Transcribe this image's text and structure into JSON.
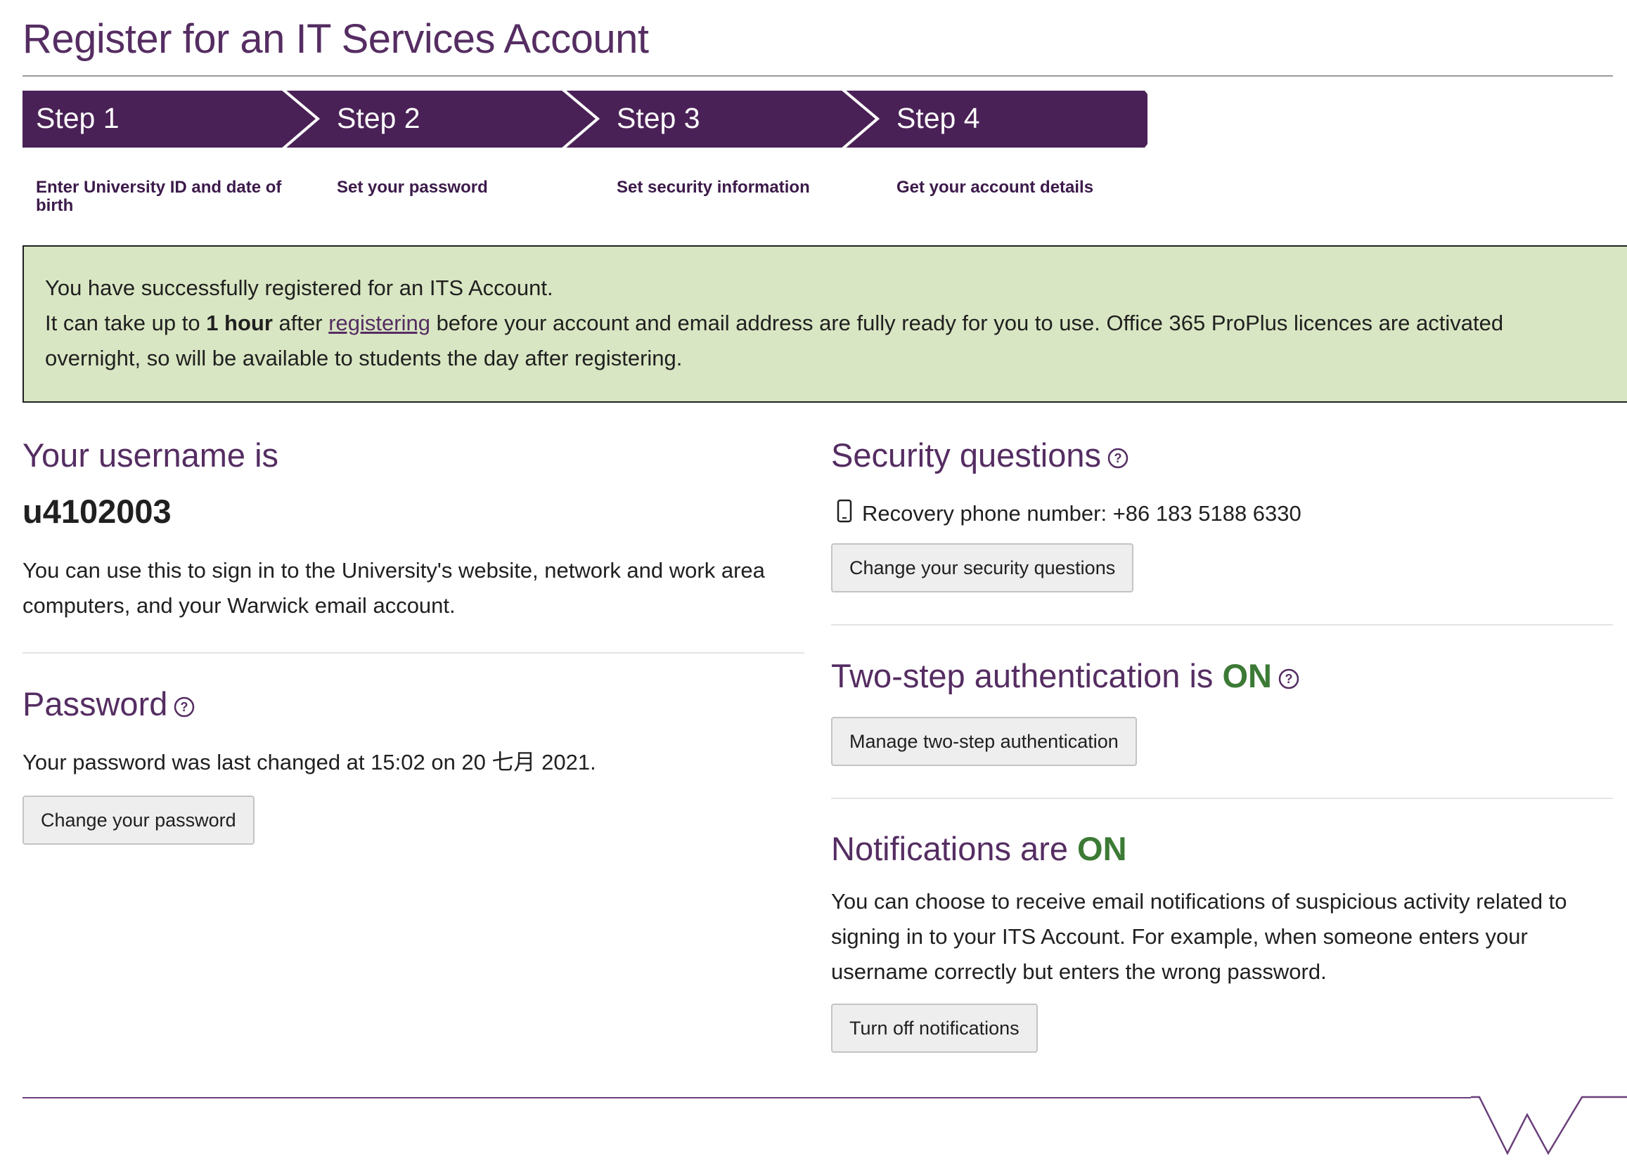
{
  "page": {
    "title": "Register for an IT Services Account"
  },
  "steps": [
    {
      "title": "Step 1",
      "description": "Enter University ID and date of birth"
    },
    {
      "title": "Step 2",
      "description": "Set your password"
    },
    {
      "title": "Step 3",
      "description": "Set security information"
    },
    {
      "title": "Step 4",
      "description": "Get your account details"
    }
  ],
  "alert": {
    "line1": "You have successfully registered for an ITS Account.",
    "line2_prefix": "It can take up to ",
    "line2_bold": "1 hour",
    "line2_mid": " after ",
    "line2_link": "registering",
    "line2_suffix": " before your account and email address are fully ready for you to use. Office 365 ProPlus licences are activated overnight, so will be available to students the day after registering."
  },
  "username": {
    "heading": "Your username is",
    "value": "u4102003",
    "description": "You can use this to sign in to the University's website, network and work area computers, and your Warwick email account."
  },
  "password": {
    "heading": "Password",
    "last_changed": "Your password was last changed at 15:02 on 20 七月 2021.",
    "button": "Change your password"
  },
  "security": {
    "heading": "Security questions",
    "phone": "Recovery phone number: +86 183 5188 6330",
    "button": "Change your security questions"
  },
  "two_step": {
    "heading": "Two-step authentication is ",
    "status": "ON",
    "button": "Manage two-step authentication"
  },
  "notifications": {
    "heading": "Notifications are ",
    "status": "ON",
    "description": "You can choose to receive email notifications of suspicious activity related to signing in to your ITS Account. For example, when someone enters your username correctly but enters the wrong password.",
    "button": "Turn off notifications"
  },
  "colors": {
    "brand_purple": "#552d62",
    "step_bar": "#4a2156",
    "status_on": "#3c7a35",
    "alert_bg": "#d9e6c3"
  },
  "icons": {
    "help": "question-circle-icon",
    "phone": "mobile-phone-icon",
    "logo": "warwick-w-logo"
  }
}
